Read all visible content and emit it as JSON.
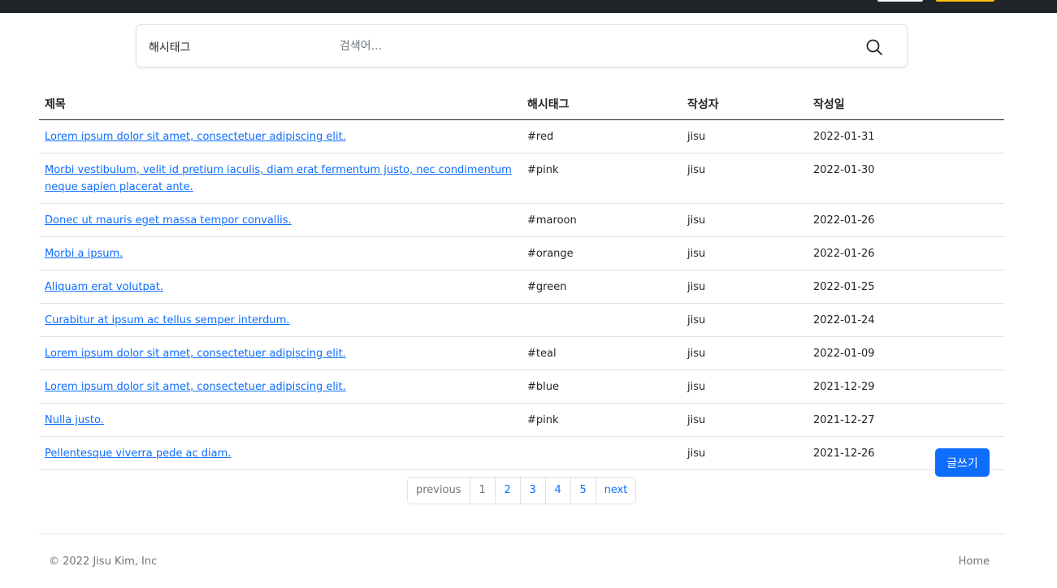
{
  "search": {
    "type_label": "해시태그",
    "placeholder": "검색어..."
  },
  "table": {
    "headers": [
      "제목",
      "해시태그",
      "작성자",
      "작성일"
    ],
    "rows": [
      {
        "title": "Lorem ipsum dolor sit amet, consectetuer adipiscing elit.",
        "hashtag": "#red",
        "author": "jisu",
        "date": "2022-01-31"
      },
      {
        "title": "Morbi vestibulum, velit id pretium iaculis, diam erat fermentum justo, nec condimentum neque sapien placerat ante.",
        "hashtag": "#pink",
        "author": "jisu",
        "date": "2022-01-30"
      },
      {
        "title": "Donec ut mauris eget massa tempor convallis.",
        "hashtag": "#maroon",
        "author": "jisu",
        "date": "2022-01-26"
      },
      {
        "title": "Morbi a ipsum.",
        "hashtag": "#orange",
        "author": "jisu",
        "date": "2022-01-26"
      },
      {
        "title": "Aliquam erat volutpat.",
        "hashtag": "#green",
        "author": "jisu",
        "date": "2022-01-25"
      },
      {
        "title": "Curabitur at ipsum ac tellus semper interdum.",
        "hashtag": "",
        "author": "jisu",
        "date": "2022-01-24"
      },
      {
        "title": "Lorem ipsum dolor sit amet, consectetuer adipiscing elit.",
        "hashtag": "#teal",
        "author": "jisu",
        "date": "2022-01-09"
      },
      {
        "title": "Lorem ipsum dolor sit amet, consectetuer adipiscing elit.",
        "hashtag": "#blue",
        "author": "jisu",
        "date": "2021-12-29"
      },
      {
        "title": "Nulla justo.",
        "hashtag": "#pink",
        "author": "jisu",
        "date": "2021-12-27"
      },
      {
        "title": "Pellentesque viverra pede ac diam.",
        "hashtag": "",
        "author": "jisu",
        "date": "2021-12-26"
      }
    ]
  },
  "write_button": "글쓰기",
  "pagination": {
    "previous": "previous",
    "pages": [
      "1",
      "2",
      "3",
      "4",
      "5"
    ],
    "next": "next"
  },
  "footer": {
    "copyright": "© 2022 Jisu Kim, Inc",
    "home": "Home"
  },
  "colors": {
    "link": "#0d6efd",
    "primary_button": "#0d6efd",
    "navbar": "#212529",
    "muted": "#6c757d"
  },
  "icons": {
    "search": "search-icon"
  }
}
